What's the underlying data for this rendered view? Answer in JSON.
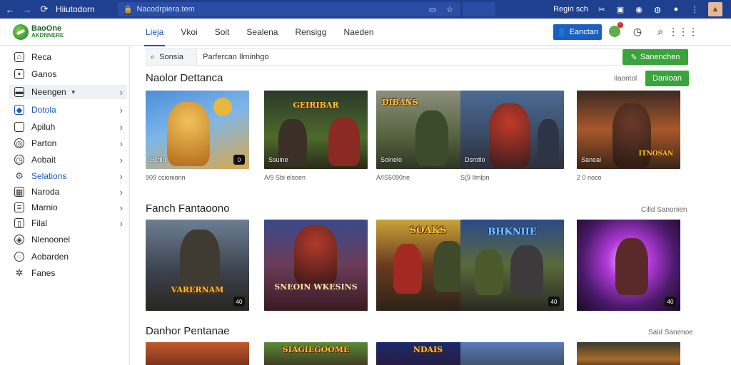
{
  "browser": {
    "tab_title": "Hiiutodorn",
    "url": "Nacodrpiera.tem",
    "profile_label": "Regiri sch"
  },
  "app": {
    "logo_line1": "BaoOne",
    "logo_line2": "AKDNNERE",
    "nav_tabs": [
      "Lieja",
      "Vkoi",
      "Soit",
      "Sealena",
      "Rensigg",
      "Naeden"
    ],
    "primary_button": "Eanctan"
  },
  "sidebar": {
    "items": [
      {
        "label": "Reca",
        "icon": "home-icon"
      },
      {
        "label": "Ganos",
        "icon": "gamepad-icon"
      },
      {
        "label": "Neengen",
        "icon": "folder-icon"
      },
      {
        "label": "Dotola",
        "icon": "tag-icon"
      },
      {
        "label": "Apiluh",
        "icon": "checkbox-icon"
      },
      {
        "label": "Parton",
        "icon": "target-icon"
      },
      {
        "label": "Aobait",
        "icon": "clock-icon"
      },
      {
        "label": "Selations",
        "icon": "settings-icon"
      },
      {
        "label": "Naroda",
        "icon": "grid-icon"
      },
      {
        "label": "Marnio",
        "icon": "document-icon"
      },
      {
        "label": "Filal",
        "icon": "book-icon"
      },
      {
        "label": "Nlenoonel",
        "icon": "shield-icon"
      },
      {
        "label": "Aobarden",
        "icon": "globe-icon"
      },
      {
        "label": "Fanes",
        "icon": "puzzle-icon"
      }
    ]
  },
  "search": {
    "label": "Sonsia",
    "value": "Parfercan Ilminhgo",
    "button": "Sanenchen"
  },
  "sections": [
    {
      "title": "Naolor Dettanca",
      "link": "Ilaontol",
      "button": "Danioan",
      "cards": [
        {
          "label": "Bcrilo",
          "meta": "909 ccioniorin",
          "badge": "0"
        },
        {
          "label": "Ssuine",
          "meta": "A/9 Sbi elsoen",
          "badge": ""
        },
        {
          "label": "Soinelo",
          "meta": "A/IS5090ne",
          "badge": "",
          "banner": "DIBANS"
        },
        {
          "label": "Dsrotlo",
          "meta": "S(9 Ilmlpn",
          "badge": ""
        },
        {
          "label": "Saneal",
          "meta": "2 0 noco",
          "badge": "",
          "banner": "ITNOSAN"
        }
      ]
    },
    {
      "title": "Fanch Fantaoono",
      "link": "Cilld Sanonien",
      "cards": [
        {
          "banner": "VARERNAM",
          "badge": "40"
        },
        {
          "banner": "SNEOIN WKESINS",
          "badge": "",
          "badge_blue": true
        },
        {
          "banner": "SOAKS",
          "badge": "40"
        },
        {
          "banner": "BHKNIIE",
          "badge": "40"
        },
        {
          "banner": "",
          "badge": "40"
        }
      ]
    },
    {
      "title": "Danhor Pentanae",
      "link": "Sald Sanenoe",
      "cards": [
        {
          "banner": ""
        },
        {
          "banner": "SIAGIEGOOME"
        },
        {
          "banner": "NDAIS"
        },
        {
          "banner": ""
        },
        {
          "banner": ""
        }
      ]
    }
  ],
  "colors": {
    "browser_bar": "#1f3f8f",
    "accent_blue": "#1b5fc1",
    "accent_green": "#3aa33b"
  }
}
